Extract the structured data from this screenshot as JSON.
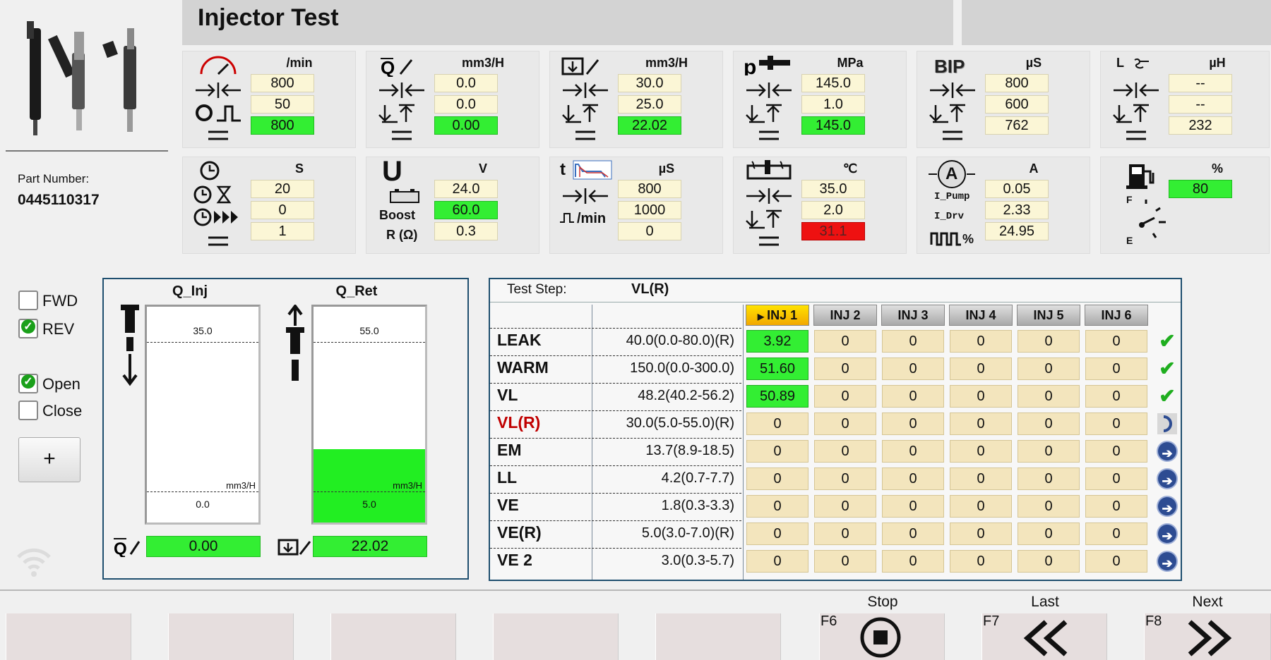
{
  "header": {
    "title": "Injector Test"
  },
  "part": {
    "label": "Part Number:",
    "value": "0445110317"
  },
  "panels": {
    "speed": {
      "unit": "/min",
      "values": [
        "800",
        "50",
        "800"
      ]
    },
    "injection": {
      "unit": "mm3/H",
      "values": [
        "0.0",
        "0.0",
        "0.00"
      ]
    },
    "return": {
      "unit": "mm3/H",
      "values": [
        "30.0",
        "25.0",
        "22.02"
      ]
    },
    "pressure": {
      "unit": "MPa",
      "values": [
        "145.0",
        "1.0",
        "145.0"
      ]
    },
    "bip": {
      "icon_text": "BIP",
      "unit": "µS",
      "values": [
        "800",
        "600",
        "762"
      ]
    },
    "inductance": {
      "icon_text": "L",
      "unit": "µH",
      "values": [
        "--",
        "--",
        "232"
      ]
    },
    "time": {
      "unit": "S",
      "values": [
        "20",
        "0",
        "1"
      ]
    },
    "voltage": {
      "icon_text": "U",
      "unit": "V",
      "boost_label": "Boost",
      "r_label": "R (Ω)",
      "values": [
        "24.0",
        "60.0",
        "0.3"
      ]
    },
    "pulse": {
      "icon_text": "t",
      "min_label": "/min",
      "unit": "µS",
      "values": [
        "800",
        "1000",
        "0"
      ]
    },
    "temperature": {
      "unit": "℃",
      "values": [
        "35.0",
        "2.0",
        "31.1"
      ]
    },
    "current": {
      "icon_text": "A",
      "unit": "A",
      "labels": [
        "I_Pump",
        "I_Drv",
        "%"
      ],
      "values": [
        "0.05",
        "2.33",
        "24.95"
      ]
    },
    "fuel": {
      "unit": "%",
      "labels": [
        "F",
        "E"
      ],
      "value": "80"
    }
  },
  "controls": {
    "fwd": {
      "label": "FWD",
      "checked": false
    },
    "rev": {
      "label": "REV",
      "checked": true
    },
    "open": {
      "label": "Open",
      "checked": true
    },
    "close": {
      "label": "Close",
      "checked": false
    },
    "plus_label": "+"
  },
  "flow": {
    "q_inj": {
      "title": "Q_Inj",
      "top": "35.0",
      "bottom": "0.0",
      "unit": "mm3/H",
      "value": "0.00",
      "fill_fraction": 0.0
    },
    "q_ret": {
      "title": "Q_Ret",
      "top": "55.0",
      "bottom": "5.0",
      "unit": "mm3/H",
      "value": "22.02",
      "fill_fraction": 0.34
    }
  },
  "test": {
    "step_label": "Test Step:",
    "step_value": "VL(R)",
    "injectors": [
      "INJ 1",
      "INJ 2",
      "INJ 3",
      "INJ 4",
      "INJ 5",
      "INJ 6"
    ],
    "active_injector_marker": "▶",
    "rows": [
      {
        "name": "LEAK",
        "spec": "40.0(0.0-80.0)(R)",
        "values": [
          "3.92",
          "0",
          "0",
          "0",
          "0",
          "0"
        ],
        "status": "ok"
      },
      {
        "name": "WARM",
        "spec": "150.0(0.0-300.0)",
        "values": [
          "51.60",
          "0",
          "0",
          "0",
          "0",
          "0"
        ],
        "status": "ok"
      },
      {
        "name": "VL",
        "spec": "48.2(40.2-56.2)",
        "values": [
          "50.89",
          "0",
          "0",
          "0",
          "0",
          "0"
        ],
        "status": "ok"
      },
      {
        "name": "VL(R)",
        "spec": "30.0(5.0-55.0)(R)",
        "values": [
          "0",
          "0",
          "0",
          "0",
          "0",
          "0"
        ],
        "status": "running"
      },
      {
        "name": "EM",
        "spec": "13.7(8.9-18.5)",
        "values": [
          "0",
          "0",
          "0",
          "0",
          "0",
          "0"
        ],
        "status": "pending"
      },
      {
        "name": "LL",
        "spec": "4.2(0.7-7.7)",
        "values": [
          "0",
          "0",
          "0",
          "0",
          "0",
          "0"
        ],
        "status": "pending"
      },
      {
        "name": "VE",
        "spec": "1.8(0.3-3.3)",
        "values": [
          "0",
          "0",
          "0",
          "0",
          "0",
          "0"
        ],
        "status": "pending"
      },
      {
        "name": "VE(R)",
        "spec": "5.0(3.0-7.0)(R)",
        "values": [
          "0",
          "0",
          "0",
          "0",
          "0",
          "0"
        ],
        "status": "pending"
      },
      {
        "name": "VE 2",
        "spec": "3.0(0.3-5.7)",
        "values": [
          "0",
          "0",
          "0",
          "0",
          "0",
          "0"
        ],
        "status": "pending"
      }
    ]
  },
  "footer": {
    "stop": {
      "key": "F6",
      "label": "Stop"
    },
    "last": {
      "key": "F7",
      "label": "Last"
    },
    "next": {
      "key": "F8",
      "label": "Next"
    }
  },
  "colors": {
    "ok": "#33ee33",
    "alarm": "#ee1111",
    "input": "#fbf6d6",
    "active_step": "#c00000",
    "border": "#1f4f6f"
  }
}
